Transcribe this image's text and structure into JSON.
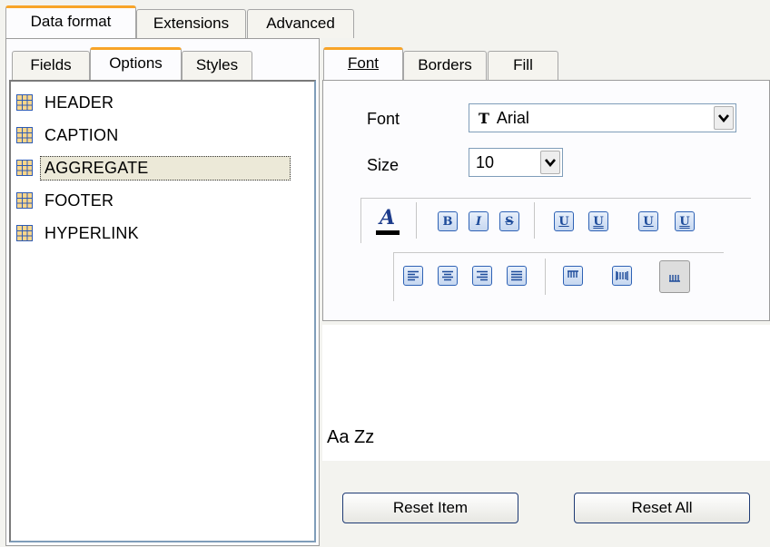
{
  "main_tabs": [
    "Data format",
    "Extensions",
    "Advanced"
  ],
  "sub_tabs": [
    "Fields",
    "Options",
    "Styles"
  ],
  "font_tabs": [
    "Font",
    "Borders",
    "Fill"
  ],
  "list_items": [
    "HEADER",
    "CAPTION",
    "AGGREGATE",
    "FOOTER",
    "HYPERLINK"
  ],
  "selected_item": "AGGREGATE",
  "font": {
    "label": "Font",
    "value": "Arial",
    "icon": "truetype-font-icon"
  },
  "size": {
    "label": "Size",
    "value": "10"
  },
  "preview_text": "Aa Zz",
  "buttons": {
    "reset_item": "Reset Item",
    "reset_all": "Reset All"
  },
  "colors": {
    "active_tab_accent": "#f8a428",
    "button_border": "#1e3a74",
    "icon_blue": "#1d4b9a"
  }
}
